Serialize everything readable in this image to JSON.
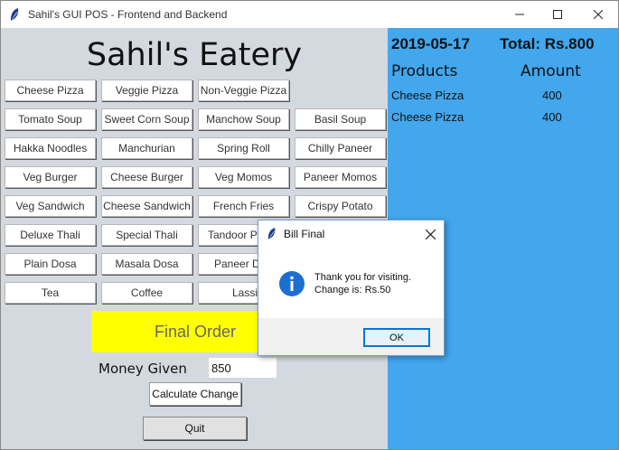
{
  "window": {
    "title": "Sahil's GUI POS - Frontend and Backend"
  },
  "left": {
    "heading": "Sahil's Eatery",
    "items": [
      "Cheese Pizza",
      "Veggie Pizza",
      "Non-Veggie Pizza",
      "Tomato Soup",
      "Sweet Corn Soup",
      "Manchow Soup",
      "Basil Soup",
      "Hakka Noodles",
      "Manchurian",
      "Spring Roll",
      "Chilly Paneer",
      "Veg Burger",
      "Cheese Burger",
      "Veg Momos",
      "Paneer Momos",
      "Veg Sandwich",
      "Cheese Sandwich",
      "French Fries",
      "Crispy Potato",
      "Deluxe Thali",
      "Special Thali",
      "Tandoor P",
      "Plain Dosa",
      "Masala Dosa",
      "Paneer D",
      "Tea",
      "Coffee",
      "Lassi"
    ],
    "final_order_label": "Final Order",
    "money_label": "Money Given",
    "money_value": "850",
    "calculate_label": "Calculate Change",
    "quit_label": "Quit"
  },
  "bill": {
    "date": "2019-05-17",
    "total": "Total: Rs.800",
    "products_header": "Products",
    "amount_header": "Amount",
    "rows": [
      {
        "product": "Cheese Pizza",
        "amount": "400"
      },
      {
        "product": "Cheese Pizza",
        "amount": "400"
      }
    ]
  },
  "dialog": {
    "title": "Bill Final",
    "line1": "Thank you for visiting.",
    "line2": "Change is: Rs.50",
    "ok_label": "OK"
  },
  "colors": {
    "bill_panel": "#42a7ed",
    "final_order": "#ffff00",
    "left_panel": "#d4d9e0"
  }
}
